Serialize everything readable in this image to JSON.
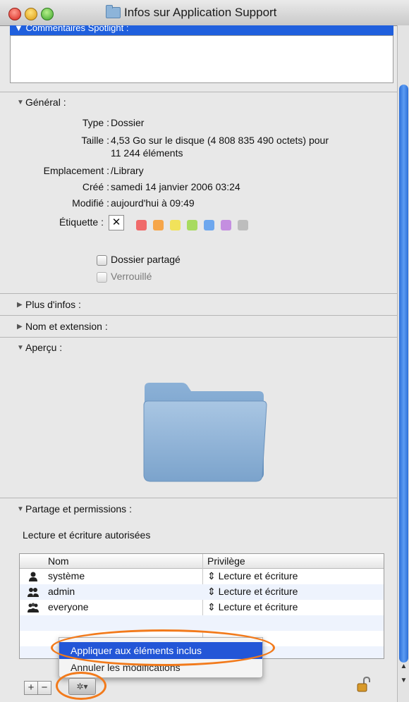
{
  "window": {
    "title": "Infos sur Application Support"
  },
  "spotlight": {
    "header": "▼ Commentaires Spotlight :"
  },
  "general": {
    "header": "Général :",
    "type_label": "Type :",
    "type_value": "Dossier",
    "size_label": "Taille :",
    "size_value_line1": "4,53 Go sur le disque (4 808 835 490 octets) pour",
    "size_value_line2": "11 244 éléments",
    "location_label": "Emplacement :",
    "location_value": "/Library",
    "created_label": "Créé :",
    "created_value": "samedi 14 janvier 2006 03:24",
    "modified_label": "Modifié :",
    "modified_value": "aujourd'hui à 09:49",
    "label_label": "Étiquette :",
    "label_colors": [
      "#f06a6a",
      "#f6a64a",
      "#f1e25a",
      "#a8db5f",
      "#6ea7ee",
      "#c48ee0",
      "#bdbdbd"
    ],
    "shared_folder": "Dossier partagé",
    "locked": "Verrouillé"
  },
  "more_info": {
    "header": "Plus d'infos :"
  },
  "name_ext": {
    "header": "Nom et extension :"
  },
  "preview": {
    "header": "Aperçu :"
  },
  "sharing": {
    "header": "Partage et permissions :",
    "status": "Lecture et écriture autorisées",
    "col_name": "Nom",
    "col_privilege": "Privilège",
    "rows": [
      {
        "name": "système",
        "privilege": "Lecture et écriture"
      },
      {
        "name": "admin",
        "privilege": "Lecture et écriture"
      },
      {
        "name": "everyone",
        "privilege": "Lecture et écriture"
      }
    ]
  },
  "menu": {
    "apply": "Appliquer aux éléments inclus",
    "revert": "Annuler les modifications"
  },
  "buttons": {
    "add": "+",
    "remove": "−",
    "gear": "✲▾"
  },
  "accent": "#f27a1b"
}
